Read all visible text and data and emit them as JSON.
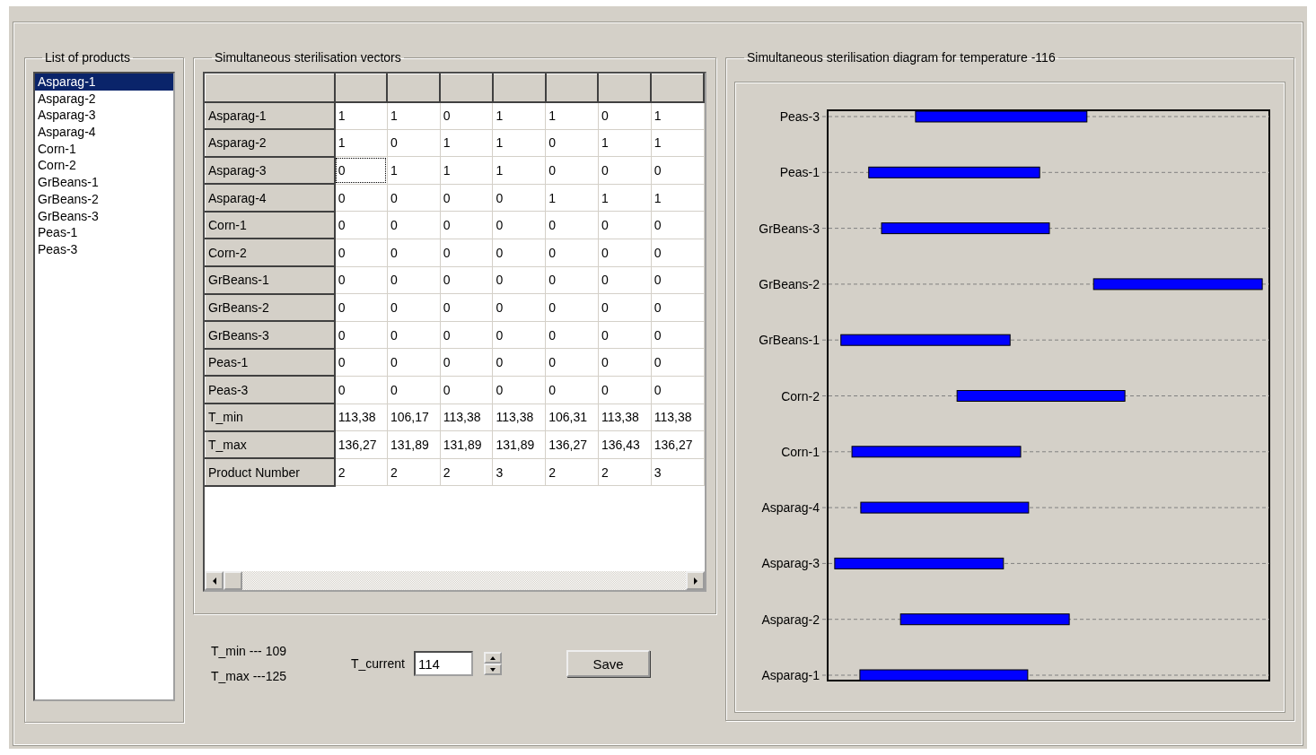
{
  "products": {
    "title": "List of products",
    "items": [
      {
        "label": "Asparag-1",
        "selected": true
      },
      {
        "label": "Asparag-2",
        "selected": false
      },
      {
        "label": "Asparag-3",
        "selected": false
      },
      {
        "label": "Asparag-4",
        "selected": false
      },
      {
        "label": "Corn-1",
        "selected": false
      },
      {
        "label": "Corn-2",
        "selected": false
      },
      {
        "label": "GrBeans-1",
        "selected": false
      },
      {
        "label": "GrBeans-2",
        "selected": false
      },
      {
        "label": "GrBeans-3",
        "selected": false
      },
      {
        "label": "Peas-1",
        "selected": false
      },
      {
        "label": "Peas-3",
        "selected": false
      }
    ]
  },
  "vectors": {
    "title": "Simultaneous sterilisation vectors",
    "rows": [
      {
        "label": "Asparag-1",
        "cells": [
          {
            "value": "1",
            "focused": false
          },
          {
            "value": "1",
            "focused": false
          },
          {
            "value": "0",
            "focused": false
          },
          {
            "value": "1",
            "focused": false
          },
          {
            "value": "1",
            "focused": false
          },
          {
            "value": "0",
            "focused": false
          },
          {
            "value": "1",
            "focused": false
          }
        ]
      },
      {
        "label": "Asparag-2",
        "cells": [
          {
            "value": "1",
            "focused": false
          },
          {
            "value": "0",
            "focused": false
          },
          {
            "value": "1",
            "focused": false
          },
          {
            "value": "1",
            "focused": false
          },
          {
            "value": "0",
            "focused": false
          },
          {
            "value": "1",
            "focused": false
          },
          {
            "value": "1",
            "focused": false
          }
        ]
      },
      {
        "label": "Asparag-3",
        "cells": [
          {
            "value": "0",
            "focused": true
          },
          {
            "value": "1",
            "focused": false
          },
          {
            "value": "1",
            "focused": false
          },
          {
            "value": "1",
            "focused": false
          },
          {
            "value": "0",
            "focused": false
          },
          {
            "value": "0",
            "focused": false
          },
          {
            "value": "0",
            "focused": false
          }
        ]
      },
      {
        "label": "Asparag-4",
        "cells": [
          {
            "value": "0",
            "focused": false
          },
          {
            "value": "0",
            "focused": false
          },
          {
            "value": "0",
            "focused": false
          },
          {
            "value": "0",
            "focused": false
          },
          {
            "value": "1",
            "focused": false
          },
          {
            "value": "1",
            "focused": false
          },
          {
            "value": "1",
            "focused": false
          }
        ]
      },
      {
        "label": "Corn-1",
        "cells": [
          {
            "value": "0",
            "focused": false
          },
          {
            "value": "0",
            "focused": false
          },
          {
            "value": "0",
            "focused": false
          },
          {
            "value": "0",
            "focused": false
          },
          {
            "value": "0",
            "focused": false
          },
          {
            "value": "0",
            "focused": false
          },
          {
            "value": "0",
            "focused": false
          }
        ]
      },
      {
        "label": "Corn-2",
        "cells": [
          {
            "value": "0",
            "focused": false
          },
          {
            "value": "0",
            "focused": false
          },
          {
            "value": "0",
            "focused": false
          },
          {
            "value": "0",
            "focused": false
          },
          {
            "value": "0",
            "focused": false
          },
          {
            "value": "0",
            "focused": false
          },
          {
            "value": "0",
            "focused": false
          }
        ]
      },
      {
        "label": "GrBeans-1",
        "cells": [
          {
            "value": "0",
            "focused": false
          },
          {
            "value": "0",
            "focused": false
          },
          {
            "value": "0",
            "focused": false
          },
          {
            "value": "0",
            "focused": false
          },
          {
            "value": "0",
            "focused": false
          },
          {
            "value": "0",
            "focused": false
          },
          {
            "value": "0",
            "focused": false
          }
        ]
      },
      {
        "label": "GrBeans-2",
        "cells": [
          {
            "value": "0",
            "focused": false
          },
          {
            "value": "0",
            "focused": false
          },
          {
            "value": "0",
            "focused": false
          },
          {
            "value": "0",
            "focused": false
          },
          {
            "value": "0",
            "focused": false
          },
          {
            "value": "0",
            "focused": false
          },
          {
            "value": "0",
            "focused": false
          }
        ]
      },
      {
        "label": "GrBeans-3",
        "cells": [
          {
            "value": "0",
            "focused": false
          },
          {
            "value": "0",
            "focused": false
          },
          {
            "value": "0",
            "focused": false
          },
          {
            "value": "0",
            "focused": false
          },
          {
            "value": "0",
            "focused": false
          },
          {
            "value": "0",
            "focused": false
          },
          {
            "value": "0",
            "focused": false
          }
        ]
      },
      {
        "label": "Peas-1",
        "cells": [
          {
            "value": "0",
            "focused": false
          },
          {
            "value": "0",
            "focused": false
          },
          {
            "value": "0",
            "focused": false
          },
          {
            "value": "0",
            "focused": false
          },
          {
            "value": "0",
            "focused": false
          },
          {
            "value": "0",
            "focused": false
          },
          {
            "value": "0",
            "focused": false
          }
        ]
      },
      {
        "label": "Peas-3",
        "cells": [
          {
            "value": "0",
            "focused": false
          },
          {
            "value": "0",
            "focused": false
          },
          {
            "value": "0",
            "focused": false
          },
          {
            "value": "0",
            "focused": false
          },
          {
            "value": "0",
            "focused": false
          },
          {
            "value": "0",
            "focused": false
          },
          {
            "value": "0",
            "focused": false
          }
        ]
      },
      {
        "label": "T_min",
        "cells": [
          {
            "value": "113,38",
            "focused": false
          },
          {
            "value": "106,17",
            "focused": false
          },
          {
            "value": "113,38",
            "focused": false
          },
          {
            "value": "113,38",
            "focused": false
          },
          {
            "value": "106,31",
            "focused": false
          },
          {
            "value": "113,38",
            "focused": false
          },
          {
            "value": "113,38",
            "focused": false
          }
        ]
      },
      {
        "label": "T_max",
        "cells": [
          {
            "value": "136,27",
            "focused": false
          },
          {
            "value": "131,89",
            "focused": false
          },
          {
            "value": "131,89",
            "focused": false
          },
          {
            "value": "131,89",
            "focused": false
          },
          {
            "value": "136,27",
            "focused": false
          },
          {
            "value": "136,43",
            "focused": false
          },
          {
            "value": "136,27",
            "focused": false
          }
        ]
      },
      {
        "label": "Product Number",
        "cells": [
          {
            "value": "2",
            "focused": false
          },
          {
            "value": "2",
            "focused": false
          },
          {
            "value": "2",
            "focused": false
          },
          {
            "value": "3",
            "focused": false
          },
          {
            "value": "2",
            "focused": false
          },
          {
            "value": "2",
            "focused": false
          },
          {
            "value": "3",
            "focused": false
          }
        ]
      }
    ]
  },
  "limits": {
    "t_min": "T_min --- 109",
    "t_max": "T_max ---125"
  },
  "t_current": {
    "label": "T_current",
    "value": "114"
  },
  "save_button": "Save",
  "diagram": {
    "title": "Simultaneous sterilisation diagram for temperature -116",
    "rows": [
      "Peas-3",
      "Peas-1",
      "GrBeans-3",
      "GrBeans-2",
      "GrBeans-1",
      "Corn-2",
      "Corn-1",
      "Asparag-4",
      "Asparag-3",
      "Asparag-2",
      "Asparag-1"
    ]
  }
}
